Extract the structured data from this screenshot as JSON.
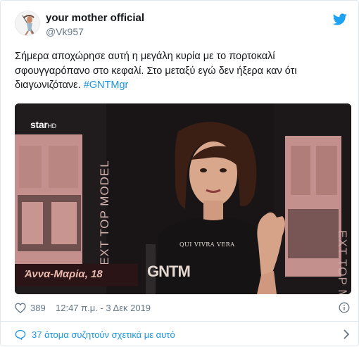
{
  "tweet": {
    "author_name": "your mother official",
    "author_handle": "@Vk957",
    "text_main": "Σήμερα αποχώρησε αυτή η μεγάλη κυρία με το πορτοκαλί σφουγγαρόπανο στο κεφαλί. Στο μεταξύ εγώ δεν ήξερα καν ότι διαγωνιζότανε.",
    "hashtag": "#GNTMgr",
    "likes": "389",
    "timestamp": "12:47 π.μ. - 3 Δεκ 2019",
    "discussion": "37 άτομα συζητούν σχετικά με αυτό"
  },
  "media": {
    "channel_logo": "star",
    "channel_logo_suffix": "HD",
    "side_text": "EXT TOP MODEL",
    "side_text_right": "EXT TOP M",
    "shirt_text": "QUI VIVRA VERA",
    "caption": "Άννα-Μαρία, 18",
    "caption_logo": "GNTM"
  },
  "colors": {
    "link": "#1b95e0",
    "secondary": "#657786",
    "twitter_blue": "#1da1f2",
    "banner_pink": "#c99591"
  },
  "icons": {
    "twitter": "twitter-bird-icon",
    "like": "heart-icon",
    "info": "info-icon",
    "discussion": "comment-bubble-icon",
    "chevron": "chevron-right-icon"
  }
}
